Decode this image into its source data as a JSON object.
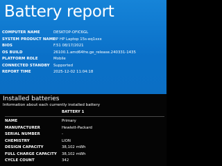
{
  "report": {
    "title": "Battery report"
  },
  "system_info": [
    {
      "label": "COMPUTER NAME",
      "value": "DESKTOP-OFIC6GL"
    },
    {
      "label": "SYSTEM PRODUCT NAME",
      "value": "HP HP Laptop 15s-eq1xxx"
    },
    {
      "label": "BIOS",
      "value": "F.51 08/17/2021"
    },
    {
      "label": "OS BUILD",
      "value": "26100.1.amd64fre.ge_release.240331-1435"
    },
    {
      "label": "PLATFORM ROLE",
      "value": "Mobile"
    },
    {
      "label": "CONNECTED STANDBY",
      "value": "Supported"
    },
    {
      "label": "REPORT TIME",
      "value": "2025-12-02   11:04:18"
    }
  ],
  "installed_batteries": {
    "title": "Installed batteries",
    "subtitle": "Information about each currently installed battery",
    "column_header": "BATTERY 1",
    "rows": [
      {
        "label": "NAME",
        "value": "Primary"
      },
      {
        "label": "MANUFACTURER",
        "value": "Hewlett-Packard"
      },
      {
        "label": "SERIAL NUMBER",
        "value": "-"
      },
      {
        "label": "CHEMISTRY",
        "value": "LION"
      },
      {
        "label": "DESIGN CAPACITY",
        "value": "38,102 mWh"
      },
      {
        "label": "FULL CHARGE CAPACITY",
        "value": "38,102 mWh"
      },
      {
        "label": "CYCLE COUNT",
        "value": "342"
      }
    ]
  }
}
